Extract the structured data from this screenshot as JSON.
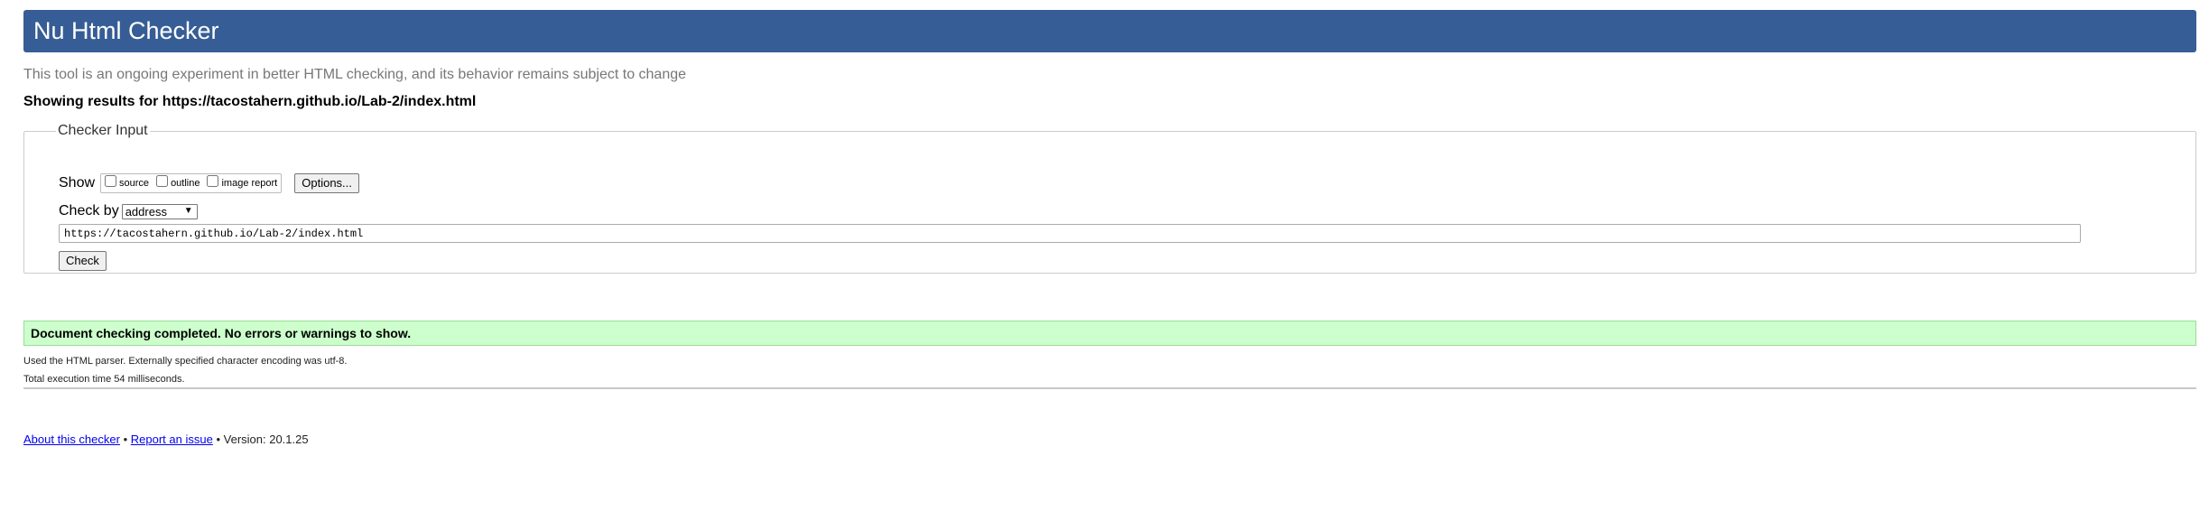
{
  "header": {
    "title": "Nu Html Checker"
  },
  "tagline": "This tool is an ongoing experiment in better HTML checking, and its behavior remains subject to change",
  "results_heading": "Showing results for https://tacostahern.github.io/Lab-2/index.html",
  "checker_input": {
    "legend": "Checker Input",
    "show_label": "Show",
    "show_options": [
      {
        "label": "source",
        "checked": false
      },
      {
        "label": "outline",
        "checked": false
      },
      {
        "label": "image report",
        "checked": false
      }
    ],
    "options_button": "Options...",
    "check_by_label": "Check by",
    "check_by_value": "address",
    "url_value": "https://tacostahern.github.io/Lab-2/index.html",
    "check_button": "Check"
  },
  "result": {
    "success_message": "Document checking completed. No errors or warnings to show.",
    "parser_info": "Used the HTML parser. Externally specified character encoding was utf-8.",
    "execution_time": "Total execution time 54 milliseconds."
  },
  "footer": {
    "about_link": "About this checker",
    "separator": "•",
    "report_link": "Report an issue",
    "version": "Version: 20.1.25"
  },
  "colors": {
    "banner": "#365d95",
    "success_bg": "#ccffcc",
    "link": "#0000ee"
  }
}
